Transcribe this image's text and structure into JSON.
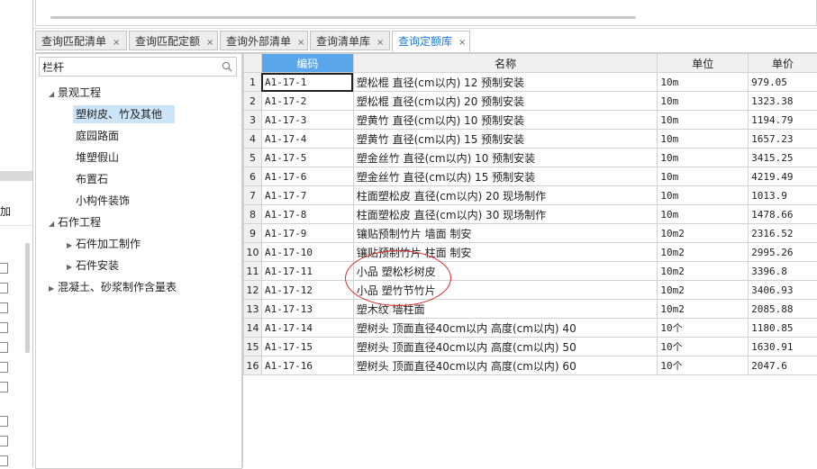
{
  "left_panel": {
    "label": "加"
  },
  "tabs": [
    {
      "label": "查询匹配清单",
      "active": false
    },
    {
      "label": "查询匹配定额",
      "active": false
    },
    {
      "label": "查询外部清单",
      "active": false
    },
    {
      "label": "查询清单库",
      "active": false
    },
    {
      "label": "查询定额库",
      "active": true
    }
  ],
  "tab_close_glyph": "×",
  "search": {
    "value": "栏杆"
  },
  "tree": [
    {
      "label": "景观工程",
      "level": 0,
      "arrow": "expanded"
    },
    {
      "label": "塑树皮、竹及其他",
      "level": 1,
      "selected": true
    },
    {
      "label": "庭园路面",
      "level": 1
    },
    {
      "label": "堆塑假山",
      "level": 1
    },
    {
      "label": "布置石",
      "level": 1
    },
    {
      "label": "小构件装饰",
      "level": 1
    },
    {
      "label": "石作工程",
      "level": 0,
      "arrow": "expanded"
    },
    {
      "label": "石件加工制作",
      "level": 1,
      "arrow": "collapsed"
    },
    {
      "label": "石件安装",
      "level": 1,
      "arrow": "collapsed"
    },
    {
      "label": "混凝土、砂浆制作含量表",
      "level": 0,
      "arrow": "collapsed"
    }
  ],
  "grid": {
    "columns": [
      "编码",
      "名称",
      "单位",
      "单价"
    ],
    "rows": [
      {
        "no": "1",
        "code": "A1-17-1",
        "name": "塑松棍 直径(cm以内) 12 预制安装",
        "unit": "10m",
        "price": "979.05"
      },
      {
        "no": "2",
        "code": "A1-17-2",
        "name": "塑松棍 直径(cm以内) 20 预制安装",
        "unit": "10m",
        "price": "1323.38"
      },
      {
        "no": "3",
        "code": "A1-17-3",
        "name": "塑黄竹 直径(cm以内) 10 预制安装",
        "unit": "10m",
        "price": "1194.79"
      },
      {
        "no": "4",
        "code": "A1-17-4",
        "name": "塑黄竹 直径(cm以内) 15 预制安装",
        "unit": "10m",
        "price": "1657.23"
      },
      {
        "no": "5",
        "code": "A1-17-5",
        "name": "塑金丝竹 直径(cm以内) 10 预制安装",
        "unit": "10m",
        "price": "3415.25"
      },
      {
        "no": "6",
        "code": "A1-17-6",
        "name": "塑金丝竹 直径(cm以内) 15 预制安装",
        "unit": "10m",
        "price": "4219.49"
      },
      {
        "no": "7",
        "code": "A1-17-7",
        "name": "柱面塑松皮 直径(cm以内) 20 现场制作",
        "unit": "10m",
        "price": "1013.9"
      },
      {
        "no": "8",
        "code": "A1-17-8",
        "name": "柱面塑松皮 直径(cm以内) 30 现场制作",
        "unit": "10m",
        "price": "1478.66"
      },
      {
        "no": "9",
        "code": "A1-17-9",
        "name": "镶贴预制竹片 墙面 制安",
        "unit": "10m2",
        "price": "2316.52"
      },
      {
        "no": "10",
        "code": "A1-17-10",
        "name": "镶贴预制竹片 柱面 制安",
        "unit": "10m2",
        "price": "2995.26"
      },
      {
        "no": "11",
        "code": "A1-17-11",
        "name": "小品 塑松杉树皮",
        "unit": "10m2",
        "price": "3396.8"
      },
      {
        "no": "12",
        "code": "A1-17-12",
        "name": "小品 塑竹节竹片",
        "unit": "10m2",
        "price": "3406.93"
      },
      {
        "no": "13",
        "code": "A1-17-13",
        "name": "塑木纹 墙柱面",
        "unit": "10m2",
        "price": "2085.88"
      },
      {
        "no": "14",
        "code": "A1-17-14",
        "name": "塑树头 顶面直径40cm以内 高度(cm以内) 40",
        "unit": "10个",
        "price": "1180.85"
      },
      {
        "no": "15",
        "code": "A1-17-15",
        "name": "塑树头 顶面直径40cm以内 高度(cm以内) 50",
        "unit": "10个",
        "price": "1630.91"
      },
      {
        "no": "16",
        "code": "A1-17-16",
        "name": "塑树头 顶面直径40cm以内 高度(cm以内) 60",
        "unit": "10个",
        "price": "2047.6"
      }
    ]
  },
  "colors": {
    "accent": "#1e7ad6",
    "header_selected": "#5aa6ea",
    "tree_selected": "#cce4f7",
    "annotation": "#d42a2a"
  }
}
